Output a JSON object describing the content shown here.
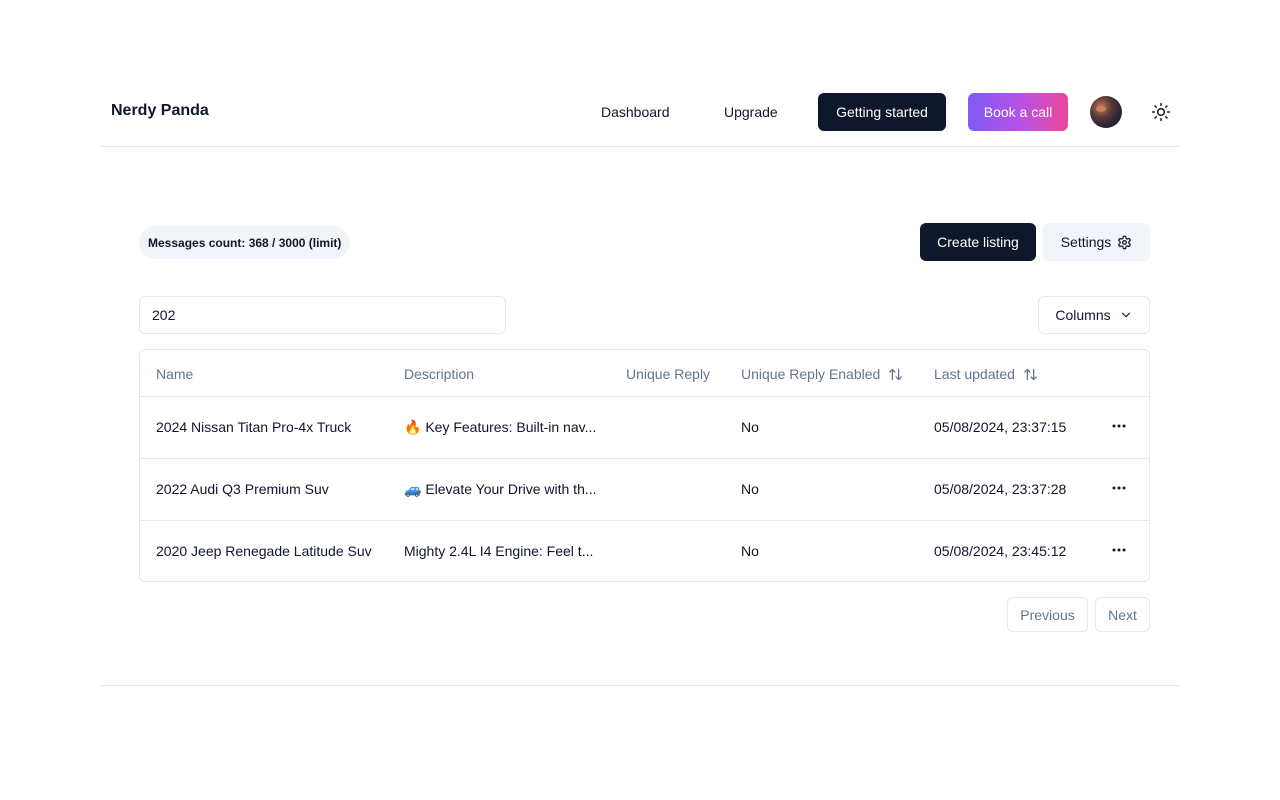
{
  "header": {
    "brand": "Nerdy Panda",
    "nav": {
      "dashboard": "Dashboard",
      "upgrade": "Upgrade"
    },
    "getting_started": "Getting started",
    "book_call": "Book a call",
    "avatar_icon": "user-avatar",
    "theme_icon": "sun-icon"
  },
  "toolbar": {
    "messages_badge": "Messages count: 368 / 3000 (limit)",
    "create_listing": "Create listing",
    "settings": "Settings",
    "settings_icon": "gear-icon"
  },
  "filter": {
    "search_value": "202",
    "columns_label": "Columns",
    "columns_icon": "chevron-down-icon"
  },
  "table": {
    "columns": [
      "Name",
      "Description",
      "Unique Reply",
      "Unique Reply Enabled",
      "Last updated"
    ],
    "sort_icon": "arrow-up-down-icon",
    "rows": [
      {
        "name": "2024 Nissan Titan Pro-4x Truck",
        "description": "🔥 Key Features: Built-in nav...",
        "unique_reply": "",
        "unique_reply_enabled": "No",
        "last_updated": "05/08/2024, 23:37:15"
      },
      {
        "name": "2022 Audi Q3 Premium Suv",
        "description": "🚙 Elevate Your Drive with th...",
        "unique_reply": "",
        "unique_reply_enabled": "No",
        "last_updated": "05/08/2024, 23:37:28"
      },
      {
        "name": "2020 Jeep Renegade Latitude Suv",
        "description": "Mighty 2.4L I4 Engine: Feel t...",
        "unique_reply": "",
        "unique_reply_enabled": "No",
        "last_updated": "05/08/2024, 23:45:12"
      }
    ],
    "row_action_icon": "more-horizontal-icon"
  },
  "pagination": {
    "previous": "Previous",
    "next": "Next"
  },
  "colors": {
    "primary_dark": "#0f172a",
    "muted": "#f1f5f9",
    "border": "#e2e8f0",
    "muted_text": "#64748b",
    "gradient_start": "#7c5cf5",
    "gradient_end": "#ec4899"
  }
}
